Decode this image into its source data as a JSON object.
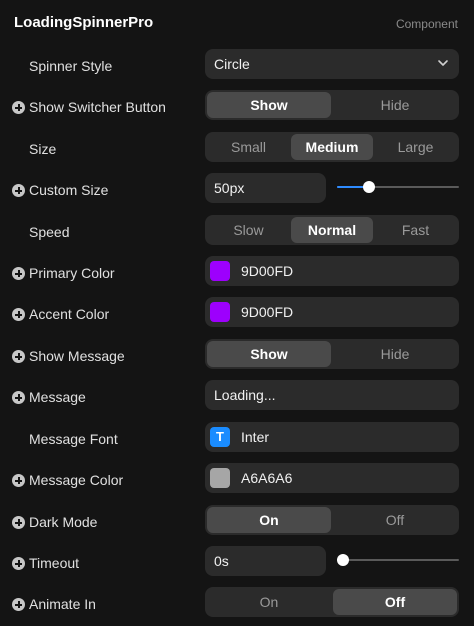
{
  "header": {
    "title": "LoadingSpinnerPro",
    "subtitle": "Component"
  },
  "rows": {
    "spinner_style": {
      "label": "Spinner Style",
      "value": "Circle"
    },
    "show_switcher": {
      "label": "Show Switcher Button",
      "options": [
        "Show",
        "Hide"
      ],
      "selected": "Show"
    },
    "size": {
      "label": "Size",
      "options": [
        "Small",
        "Medium",
        "Large"
      ],
      "selected": "Medium"
    },
    "custom_size": {
      "label": "Custom Size",
      "value": "50px",
      "slider_fraction": 0.24
    },
    "speed": {
      "label": "Speed",
      "options": [
        "Slow",
        "Normal",
        "Fast"
      ],
      "selected": "Normal"
    },
    "primary_color": {
      "label": "Primary Color",
      "hex": "9D00FD",
      "color": "#9D00FD"
    },
    "accent_color": {
      "label": "Accent Color",
      "hex": "9D00FD",
      "color": "#9D00FD"
    },
    "show_message": {
      "label": "Show Message",
      "options": [
        "Show",
        "Hide"
      ],
      "selected": "Show"
    },
    "message": {
      "label": "Message",
      "value": "Loading..."
    },
    "message_font": {
      "label": "Message Font",
      "icon": "T",
      "value": "Inter"
    },
    "message_color": {
      "label": "Message Color",
      "hex": "A6A6A6",
      "color": "#A6A6A6"
    },
    "dark_mode": {
      "label": "Dark Mode",
      "options": [
        "On",
        "Off"
      ],
      "selected": "On"
    },
    "timeout": {
      "label": "Timeout",
      "value": "0s",
      "slider_fraction": 0.0
    },
    "animate_in": {
      "label": "Animate In",
      "options": [
        "On",
        "Off"
      ],
      "selected": "Off"
    }
  },
  "colors": {
    "accent_blue": "#2E8BFF"
  }
}
